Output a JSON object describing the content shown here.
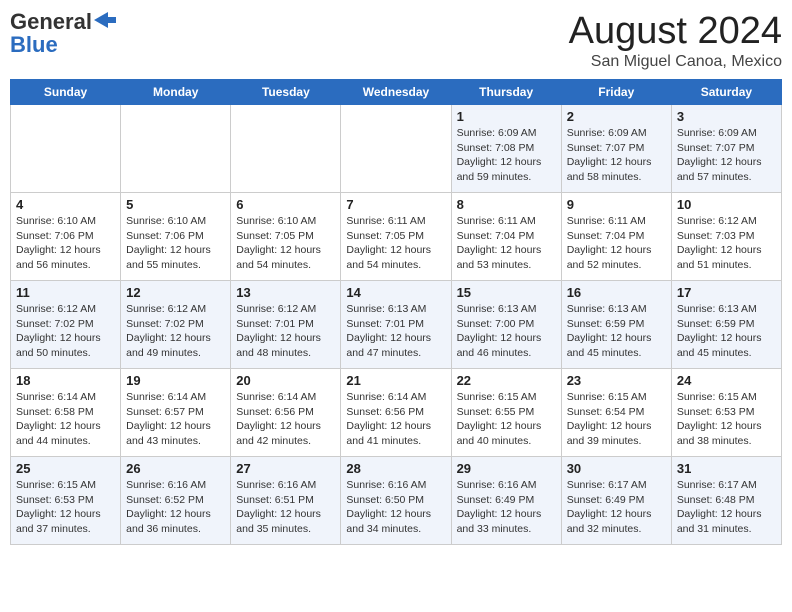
{
  "logo": {
    "part1": "General",
    "part2": "Blue"
  },
  "title": "August 2024",
  "subtitle": "San Miguel Canoa, Mexico",
  "weekdays": [
    "Sunday",
    "Monday",
    "Tuesday",
    "Wednesday",
    "Thursday",
    "Friday",
    "Saturday"
  ],
  "weeks": [
    [
      {
        "day": "",
        "info": ""
      },
      {
        "day": "",
        "info": ""
      },
      {
        "day": "",
        "info": ""
      },
      {
        "day": "",
        "info": ""
      },
      {
        "day": "1",
        "info": "Sunrise: 6:09 AM\nSunset: 7:08 PM\nDaylight: 12 hours\nand 59 minutes."
      },
      {
        "day": "2",
        "info": "Sunrise: 6:09 AM\nSunset: 7:07 PM\nDaylight: 12 hours\nand 58 minutes."
      },
      {
        "day": "3",
        "info": "Sunrise: 6:09 AM\nSunset: 7:07 PM\nDaylight: 12 hours\nand 57 minutes."
      }
    ],
    [
      {
        "day": "4",
        "info": "Sunrise: 6:10 AM\nSunset: 7:06 PM\nDaylight: 12 hours\nand 56 minutes."
      },
      {
        "day": "5",
        "info": "Sunrise: 6:10 AM\nSunset: 7:06 PM\nDaylight: 12 hours\nand 55 minutes."
      },
      {
        "day": "6",
        "info": "Sunrise: 6:10 AM\nSunset: 7:05 PM\nDaylight: 12 hours\nand 54 minutes."
      },
      {
        "day": "7",
        "info": "Sunrise: 6:11 AM\nSunset: 7:05 PM\nDaylight: 12 hours\nand 54 minutes."
      },
      {
        "day": "8",
        "info": "Sunrise: 6:11 AM\nSunset: 7:04 PM\nDaylight: 12 hours\nand 53 minutes."
      },
      {
        "day": "9",
        "info": "Sunrise: 6:11 AM\nSunset: 7:04 PM\nDaylight: 12 hours\nand 52 minutes."
      },
      {
        "day": "10",
        "info": "Sunrise: 6:12 AM\nSunset: 7:03 PM\nDaylight: 12 hours\nand 51 minutes."
      }
    ],
    [
      {
        "day": "11",
        "info": "Sunrise: 6:12 AM\nSunset: 7:02 PM\nDaylight: 12 hours\nand 50 minutes."
      },
      {
        "day": "12",
        "info": "Sunrise: 6:12 AM\nSunset: 7:02 PM\nDaylight: 12 hours\nand 49 minutes."
      },
      {
        "day": "13",
        "info": "Sunrise: 6:12 AM\nSunset: 7:01 PM\nDaylight: 12 hours\nand 48 minutes."
      },
      {
        "day": "14",
        "info": "Sunrise: 6:13 AM\nSunset: 7:01 PM\nDaylight: 12 hours\nand 47 minutes."
      },
      {
        "day": "15",
        "info": "Sunrise: 6:13 AM\nSunset: 7:00 PM\nDaylight: 12 hours\nand 46 minutes."
      },
      {
        "day": "16",
        "info": "Sunrise: 6:13 AM\nSunset: 6:59 PM\nDaylight: 12 hours\nand 45 minutes."
      },
      {
        "day": "17",
        "info": "Sunrise: 6:13 AM\nSunset: 6:59 PM\nDaylight: 12 hours\nand 45 minutes."
      }
    ],
    [
      {
        "day": "18",
        "info": "Sunrise: 6:14 AM\nSunset: 6:58 PM\nDaylight: 12 hours\nand 44 minutes."
      },
      {
        "day": "19",
        "info": "Sunrise: 6:14 AM\nSunset: 6:57 PM\nDaylight: 12 hours\nand 43 minutes."
      },
      {
        "day": "20",
        "info": "Sunrise: 6:14 AM\nSunset: 6:56 PM\nDaylight: 12 hours\nand 42 minutes."
      },
      {
        "day": "21",
        "info": "Sunrise: 6:14 AM\nSunset: 6:56 PM\nDaylight: 12 hours\nand 41 minutes."
      },
      {
        "day": "22",
        "info": "Sunrise: 6:15 AM\nSunset: 6:55 PM\nDaylight: 12 hours\nand 40 minutes."
      },
      {
        "day": "23",
        "info": "Sunrise: 6:15 AM\nSunset: 6:54 PM\nDaylight: 12 hours\nand 39 minutes."
      },
      {
        "day": "24",
        "info": "Sunrise: 6:15 AM\nSunset: 6:53 PM\nDaylight: 12 hours\nand 38 minutes."
      }
    ],
    [
      {
        "day": "25",
        "info": "Sunrise: 6:15 AM\nSunset: 6:53 PM\nDaylight: 12 hours\nand 37 minutes."
      },
      {
        "day": "26",
        "info": "Sunrise: 6:16 AM\nSunset: 6:52 PM\nDaylight: 12 hours\nand 36 minutes."
      },
      {
        "day": "27",
        "info": "Sunrise: 6:16 AM\nSunset: 6:51 PM\nDaylight: 12 hours\nand 35 minutes."
      },
      {
        "day": "28",
        "info": "Sunrise: 6:16 AM\nSunset: 6:50 PM\nDaylight: 12 hours\nand 34 minutes."
      },
      {
        "day": "29",
        "info": "Sunrise: 6:16 AM\nSunset: 6:49 PM\nDaylight: 12 hours\nand 33 minutes."
      },
      {
        "day": "30",
        "info": "Sunrise: 6:17 AM\nSunset: 6:49 PM\nDaylight: 12 hours\nand 32 minutes."
      },
      {
        "day": "31",
        "info": "Sunrise: 6:17 AM\nSunset: 6:48 PM\nDaylight: 12 hours\nand 31 minutes."
      }
    ]
  ]
}
